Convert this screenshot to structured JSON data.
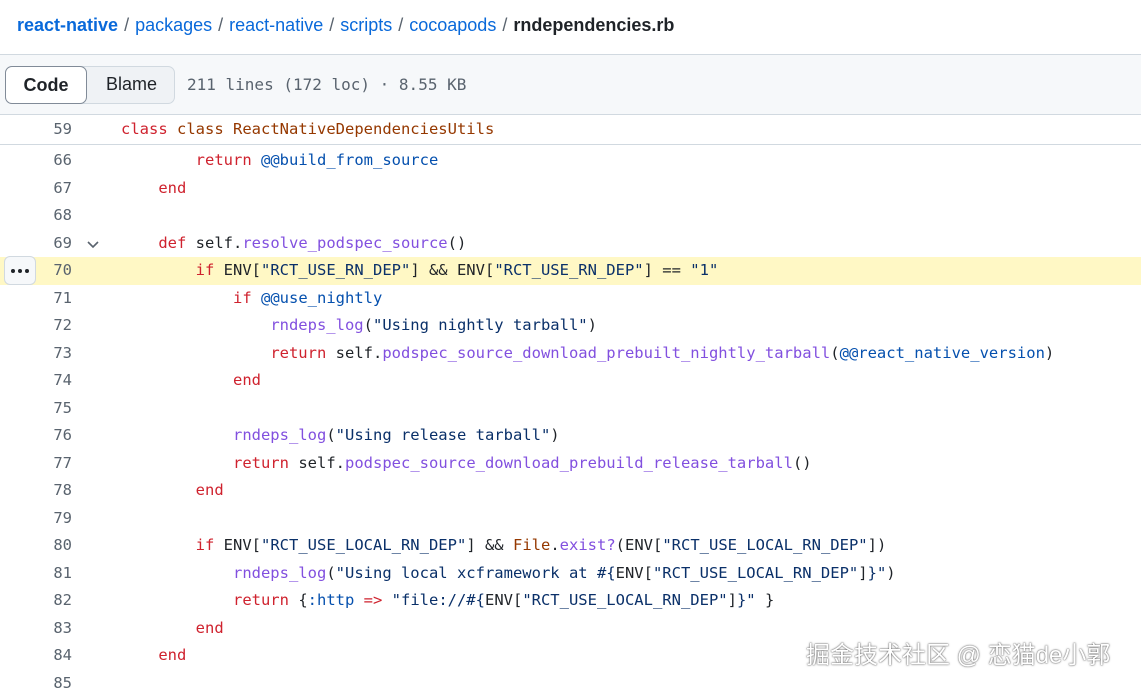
{
  "breadcrumb": {
    "parts": [
      "react-native",
      "packages",
      "react-native",
      "scripts",
      "cocoapods"
    ],
    "current": "rndependencies.rb"
  },
  "toolbar": {
    "code_label": "Code",
    "blame_label": "Blame",
    "file_meta": "211 lines (172 loc) · 8.55 KB"
  },
  "sticky": {
    "number": "59",
    "text": "class ReactNativeDependenciesUtils"
  },
  "lines": [
    {
      "n": "66"
    },
    {
      "n": "67"
    },
    {
      "n": "68"
    },
    {
      "n": "69"
    },
    {
      "n": "70"
    },
    {
      "n": "71"
    },
    {
      "n": "72"
    },
    {
      "n": "73"
    },
    {
      "n": "74"
    },
    {
      "n": "75"
    },
    {
      "n": "76"
    },
    {
      "n": "77"
    },
    {
      "n": "78"
    },
    {
      "n": "79"
    },
    {
      "n": "80"
    },
    {
      "n": "81"
    },
    {
      "n": "82"
    },
    {
      "n": "83"
    },
    {
      "n": "84"
    },
    {
      "n": "85"
    }
  ],
  "code": {
    "l66_kw": "return",
    "l66_var": "@@build_from_source",
    "l67_kw": "end",
    "l69_kw": "def",
    "l69_self": "self.",
    "l69_fn": "resolve_podspec_source",
    "l69_rest": "()",
    "l70_kw": "if",
    "l70_a": "ENV[",
    "l70_s1": "\"RCT_USE_RN_DEP\"",
    "l70_b": "] && ENV[",
    "l70_s2": "\"RCT_USE_RN_DEP\"",
    "l70_c": "] == ",
    "l70_s3": "\"1\"",
    "l71_kw": "if",
    "l71_var": "@@use_nightly",
    "l72_fn": "rndeps_log",
    "l72_a": "(",
    "l72_s": "\"Using nightly tarball\"",
    "l72_b": ")",
    "l73_kw": "return",
    "l73_self": "self.",
    "l73_fn": "podspec_source_download_prebuilt_nightly_tarball",
    "l73_a": "(",
    "l73_var": "@@react_native_version",
    "l73_b": ")",
    "l74_kw": "end",
    "l76_fn": "rndeps_log",
    "l76_a": "(",
    "l76_s": "\"Using release tarball\"",
    "l76_b": ")",
    "l77_kw": "return",
    "l77_self": "self.",
    "l77_fn": "podspec_source_download_prebuild_release_tarball",
    "l77_rest": "()",
    "l78_kw": "end",
    "l80_kw": "if",
    "l80_a": "ENV[",
    "l80_s1": "\"RCT_USE_LOCAL_RN_DEP\"",
    "l80_b": "] && ",
    "l80_cn": "File",
    "l80_dot": ".",
    "l80_fn": "exist?",
    "l80_c": "(ENV[",
    "l80_s2": "\"RCT_USE_LOCAL_RN_DEP\"",
    "l80_d": "])",
    "l81_fn": "rndeps_log",
    "l81_a": "(",
    "l81_s1": "\"Using local xcframework at #{",
    "l81_b": "ENV[",
    "l81_s2": "\"RCT_USE_LOCAL_RN_DEP\"",
    "l81_c": "]",
    "l81_s3": "}\"",
    "l81_d": ")",
    "l82_kw": "return",
    "l82_a": " {",
    "l82_sym": ":http",
    "l82_op": " => ",
    "l82_s1": "\"file://#{",
    "l82_b": "ENV[",
    "l82_s2": "\"RCT_USE_LOCAL_RN_DEP\"",
    "l82_c": "]",
    "l82_s3": "}\"",
    "l82_d": " }",
    "l83_kw": "end",
    "l84_kw": "end"
  },
  "watermark": "掘金技术社区 @ 恋猫de小郭",
  "colors": {
    "highlight_line": "#fff8c5",
    "link": "#0969da",
    "keyword": "#cf222e",
    "function": "#8250df",
    "string": "#0a3069"
  }
}
